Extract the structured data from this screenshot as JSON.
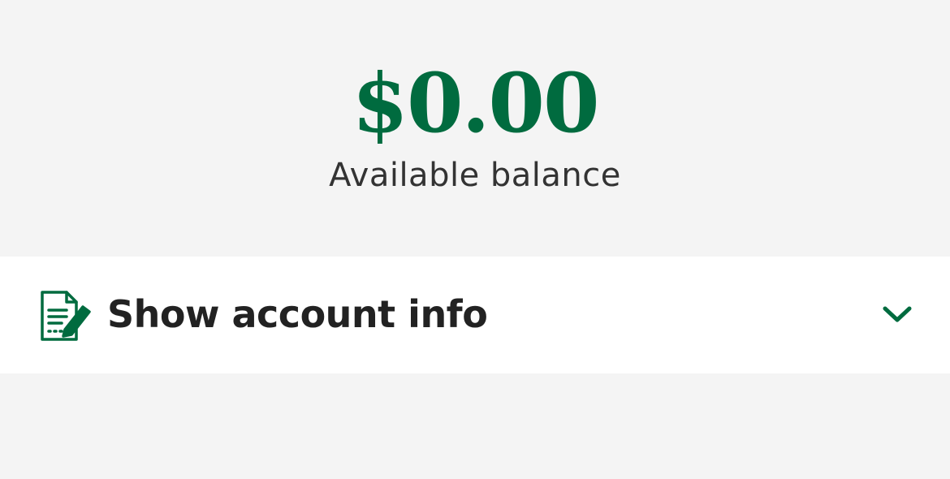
{
  "balance": {
    "amount": "$0.00",
    "label": "Available balance"
  },
  "account_info": {
    "label": "Show account info",
    "icon": "document-edit-icon",
    "expand_icon": "chevron-down-icon"
  },
  "colors": {
    "accent": "#006b3f",
    "background": "#f4f4f4",
    "row_background": "#ffffff",
    "text_primary": "#222222",
    "text_secondary": "#333333"
  }
}
